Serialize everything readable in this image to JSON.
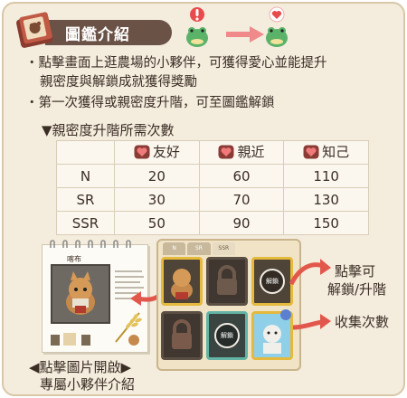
{
  "header": {
    "title": "圖鑑介紹",
    "icon": "book-icon"
  },
  "bullets": [
    {
      "line1": "・點擊畫面上逛農場的小夥伴，可獲得愛心並能提升",
      "line2": "親密度與解鎖成就獲得獎勵"
    },
    {
      "line1": "・第一次獲得或親密度升階，可至圖鑑解鎖"
    }
  ],
  "table_section": {
    "title": "▼親密度升階所需次數",
    "columns": [
      "友好",
      "親近",
      "知己"
    ],
    "rows": [
      {
        "label": "N",
        "values": [
          "20",
          "60",
          "110"
        ]
      },
      {
        "label": "SR",
        "values": [
          "30",
          "70",
          "130"
        ]
      },
      {
        "label": "SSR",
        "values": [
          "50",
          "90",
          "150"
        ]
      }
    ]
  },
  "album": {
    "title": "喀布"
  },
  "collection": {
    "tabs": [
      "N",
      "SR",
      "SSR"
    ],
    "unlock_badge": "解鎖"
  },
  "callouts": {
    "click_to_unlock_line1": "點擊可",
    "click_to_unlock_line2": "解鎖/升階",
    "collect_count": "收集次數",
    "open_card_line1": "◀點擊圖片開啟▶",
    "open_card_line2": "專屬小夥伴介紹"
  },
  "colors": {
    "accent_red": "#e2574c",
    "title_bar": "#6b5246",
    "heart": "#d9534f",
    "card_gold": "#e5b93b"
  }
}
